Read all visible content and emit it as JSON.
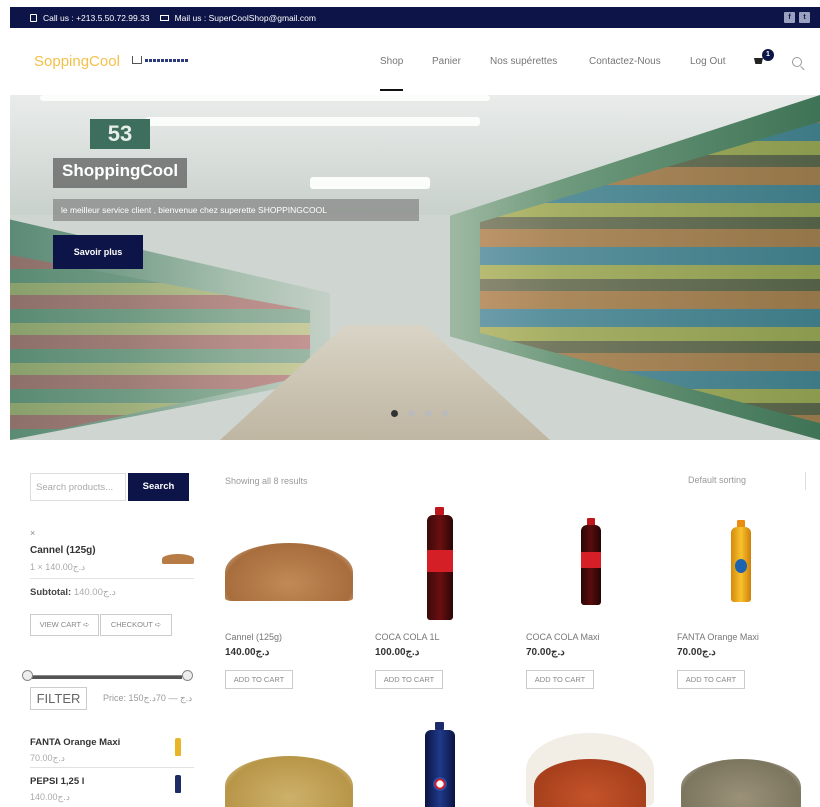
{
  "topbar": {
    "call": "Call us : +213.5.50.72.99.33",
    "mail": "Mail us : SuperCoolShop@gmail.com",
    "social": [
      "f",
      "t"
    ]
  },
  "header": {
    "logo": "SoppingCool",
    "nav": [
      "Shop",
      "Panier",
      "Nos supérettes",
      "Contactez-Nous",
      "Log Out"
    ],
    "cart_count": "1"
  },
  "hero": {
    "aisle_number": "53",
    "title": "ShoppingCool",
    "subtitle": "le meilleur service client , bienvenue chez superette SHOPPINGCOOL",
    "button": "Savoir plus",
    "slides": 4,
    "active_slide": 1
  },
  "sidebar": {
    "search_placeholder": "Search products...",
    "search_button": "Search",
    "mini_cart": {
      "remove": "×",
      "item": "Cannel (125g)",
      "qty": "1 × 140.00د.ج",
      "subtotal_label": "Subtotal:",
      "subtotal_value": "140.00د.ج",
      "view_cart": "VIEW CART",
      "checkout": "CHECKOUT"
    },
    "filter": {
      "button": "FILTER",
      "price": "Price: 150د.ج — 70د.ج"
    },
    "products": [
      {
        "name": "FANTA Orange Maxi",
        "price": "70.00د.ج"
      },
      {
        "name": "PEPSI 1,25 l",
        "price": "140.00د.ج"
      }
    ]
  },
  "shop": {
    "showing": "Showing all 8 results",
    "sorting": "Default sorting",
    "add_label": "ADD TO CART",
    "products": [
      {
        "name": "Cannel (125g)",
        "price": "140.00د.ج"
      },
      {
        "name": "COCA COLA 1L",
        "price": "100.00د.ج"
      },
      {
        "name": "COCA COLA Maxi",
        "price": "70.00د.ج"
      },
      {
        "name": "FANTA Orange Maxi",
        "price": "70.00د.ج"
      }
    ]
  },
  "colors": {
    "navy": "#0d1447",
    "logo": "#f5c04a"
  }
}
